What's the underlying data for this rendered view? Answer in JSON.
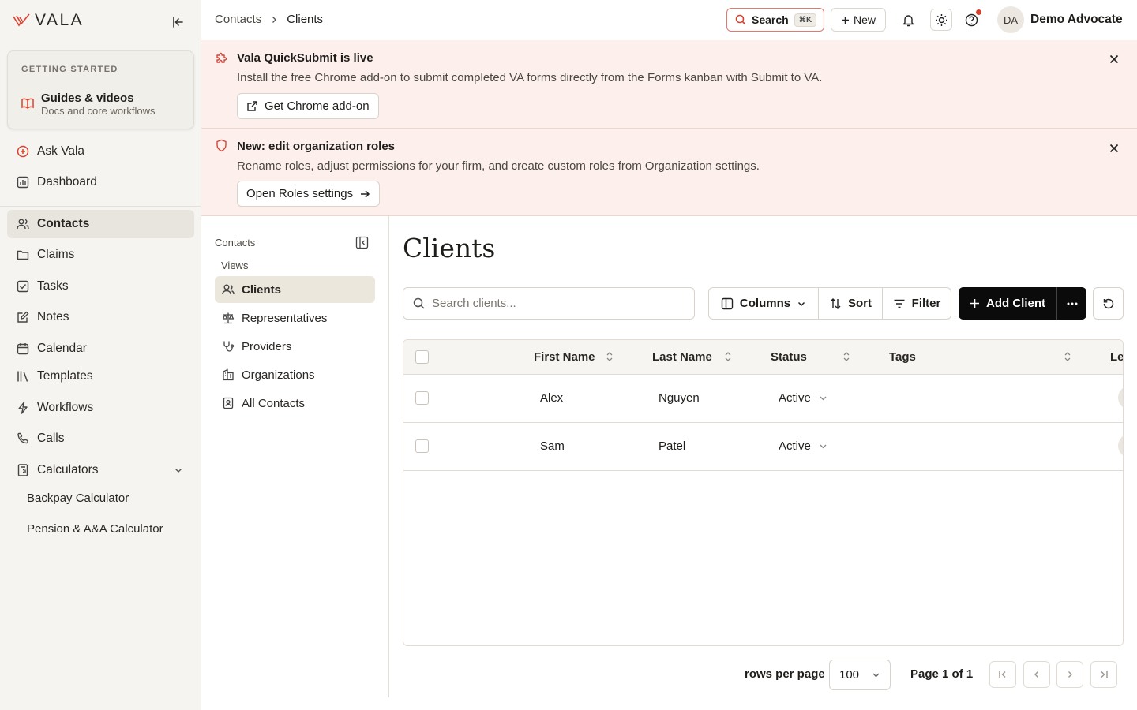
{
  "app": {
    "brand": "VALA",
    "accent": "#d9412f"
  },
  "sidebar": {
    "getting_started": {
      "label": "GETTING STARTED",
      "title": "Guides & videos",
      "subtitle": "Docs and core workflows"
    },
    "items": [
      {
        "label": "Ask Vala",
        "icon": "plus-circle-icon"
      },
      {
        "label": "Dashboard",
        "icon": "dashboard-icon"
      },
      {
        "label": "Contacts",
        "icon": "users-icon",
        "active": true
      },
      {
        "label": "Claims",
        "icon": "folder-icon"
      },
      {
        "label": "Tasks",
        "icon": "checkbox-icon"
      },
      {
        "label": "Notes",
        "icon": "note-icon"
      },
      {
        "label": "Calendar",
        "icon": "calendar-icon"
      },
      {
        "label": "Templates",
        "icon": "library-icon"
      },
      {
        "label": "Workflows",
        "icon": "bolt-icon"
      },
      {
        "label": "Calls",
        "icon": "phone-icon"
      },
      {
        "label": "Calculators",
        "icon": "calculator-icon",
        "expanded": true
      }
    ],
    "calculators": [
      "Backpay Calculator",
      "Pension & A&A Calculator"
    ]
  },
  "topbar": {
    "breadcrumb": [
      "Contacts",
      "Clients"
    ],
    "search_label": "Search",
    "search_shortcut": "⌘K",
    "new_label": "New",
    "avatar_initials": "DA",
    "user_name": "Demo Advocate"
  },
  "banners": [
    {
      "title": "Vala QuickSubmit is live",
      "text": "Install the free Chrome add-on to submit completed VA forms directly from the Forms kanban with Submit to VA.",
      "button": "Get Chrome add-on"
    },
    {
      "title": "New: edit organization roles",
      "text": "Rename roles, adjust permissions for your firm, and create custom roles from Organization settings.",
      "button": "Open Roles settings"
    }
  ],
  "subnav": {
    "title": "Contacts",
    "views_label": "Views",
    "items": [
      {
        "label": "Clients",
        "active": true
      },
      {
        "label": "Representatives"
      },
      {
        "label": "Providers"
      },
      {
        "label": "Organizations"
      },
      {
        "label": "All Contacts"
      }
    ]
  },
  "main": {
    "title": "Clients",
    "search_placeholder": "Search clients...",
    "toolbar": {
      "columns": "Columns",
      "sort": "Sort",
      "filter": "Filter",
      "add": "Add Client"
    },
    "table": {
      "columns": [
        "First Name",
        "Last Name",
        "Status",
        "Tags",
        "Le"
      ],
      "rows": [
        {
          "first": "Alex",
          "last": "Nguyen",
          "status": "Active"
        },
        {
          "first": "Sam",
          "last": "Patel",
          "status": "Active"
        }
      ]
    },
    "pagination": {
      "rows_per_page_label": "rows per page",
      "rows_per_page": "100",
      "page_info": "Page 1 of 1"
    }
  }
}
